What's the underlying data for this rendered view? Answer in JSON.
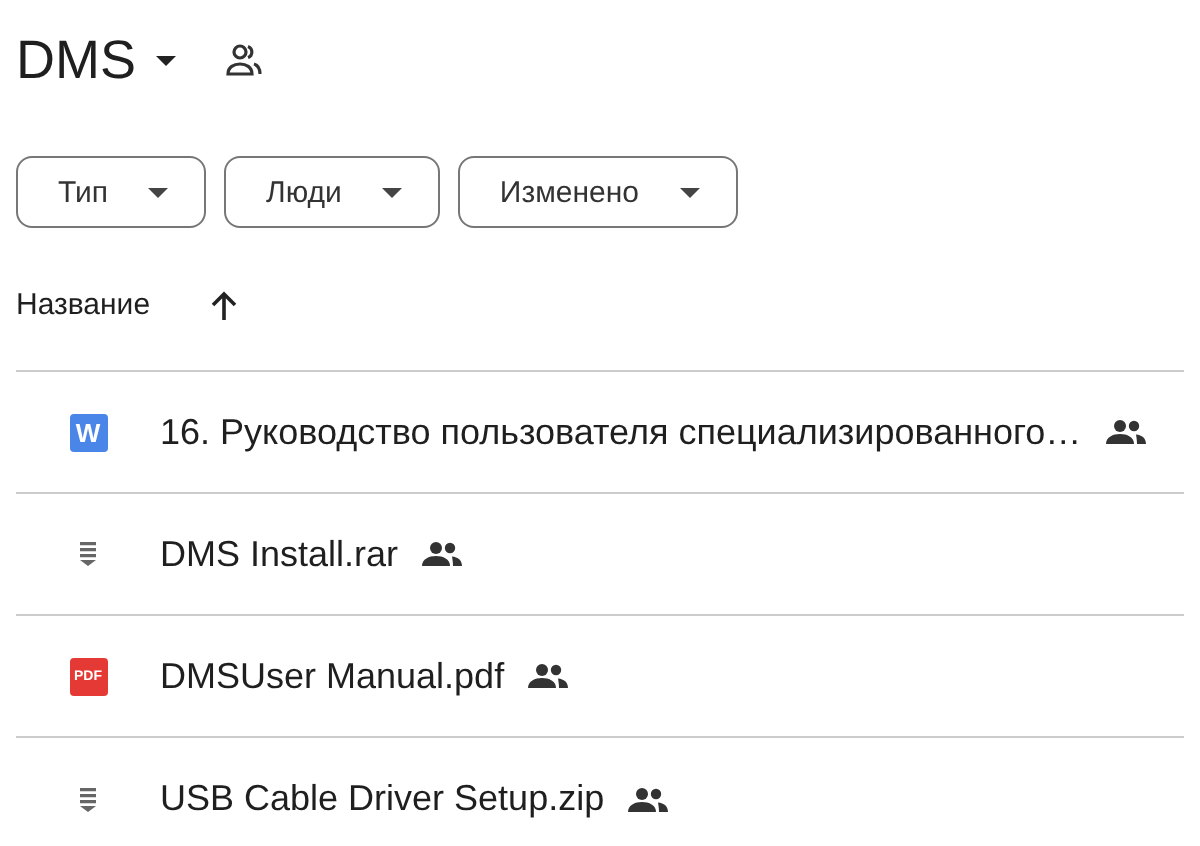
{
  "folder": {
    "title": "DMS"
  },
  "filters": [
    {
      "label": "Тип"
    },
    {
      "label": "Люди"
    },
    {
      "label": "Изменено"
    }
  ],
  "table": {
    "sort_column": {
      "label": "Название"
    },
    "rows": [
      {
        "kind": "word",
        "icon_text": "W",
        "name": "16. Руководство пользователя специализированного…",
        "shared": true
      },
      {
        "kind": "archive",
        "name": "DMS Install.rar",
        "shared": true
      },
      {
        "kind": "pdf",
        "icon_text": "PDF",
        "name": "DMSUser Manual.pdf",
        "shared": true
      },
      {
        "kind": "archive",
        "name": "USB Cable Driver Setup.zip",
        "shared": true
      }
    ]
  }
}
